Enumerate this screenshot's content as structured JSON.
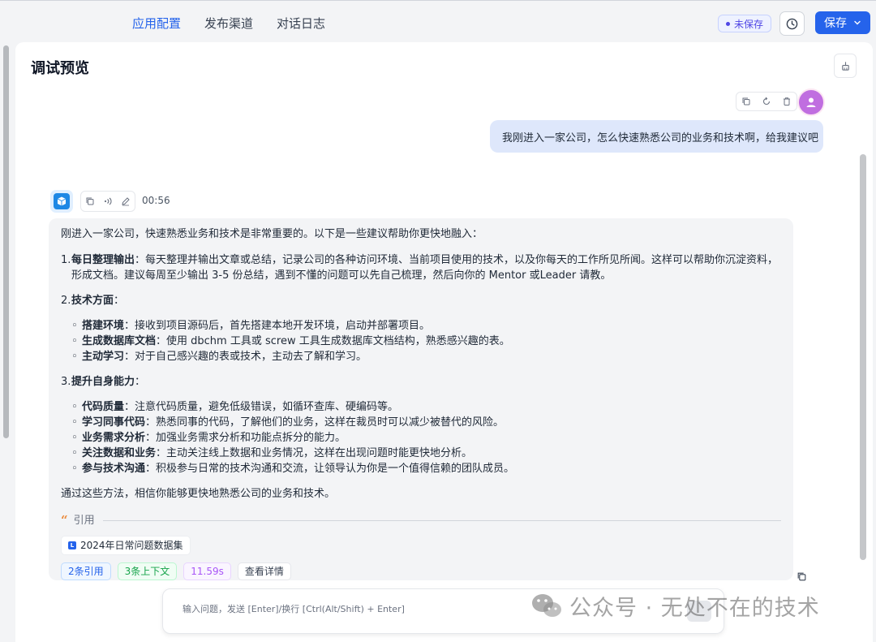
{
  "nav": {
    "tabs": [
      {
        "label": "应用配置",
        "active": true
      },
      {
        "label": "发布渠道",
        "active": false
      },
      {
        "label": "对话日志",
        "active": false
      }
    ]
  },
  "header": {
    "unsaved_label": "未保存",
    "save_label": "保存"
  },
  "panel": {
    "title": "调试预览"
  },
  "user_message": {
    "text": "我刚进入一家公司，怎么快速熟悉公司的业务和技术啊，给我建议吧"
  },
  "bot_message": {
    "time": "00:56",
    "intro": "刚进入一家公司，快速熟悉业务和技术是非常重要的。以下是一些建议帮助你更快地融入：",
    "sections": [
      {
        "num": "1.",
        "title": "每日整理输出",
        "text": "：每天整理并输出文章或总结，记录公司的各种访问环境、当前项目使用的技术，以及你每天的工作所见所闻。这样可以帮助你沉淀资料，形成文档。建议每周至少输出 3-5 份总结，遇到不懂的问题可以先自己梳理，然后向你的 Mentor 或Leader 请教。"
      },
      {
        "num": "2.",
        "title": "技术方面",
        "text": "：",
        "items": [
          {
            "title": "搭建环境",
            "text": "：接收到项目源码后，首先搭建本地开发环境，启动并部署项目。"
          },
          {
            "title": "生成数据库文档",
            "text": "：使用 dbchm 工具或 screw 工具生成数据库文档结构，熟悉感兴趣的表。"
          },
          {
            "title": "主动学习",
            "text": "：对于自己感兴趣的表或技术，主动去了解和学习。"
          }
        ]
      },
      {
        "num": "3.",
        "title": "提升自身能力",
        "text": "：",
        "items": [
          {
            "title": "代码质量",
            "text": "：注意代码质量，避免低级错误，如循环查库、硬编码等。"
          },
          {
            "title": "学习同事代码",
            "text": "：熟悉同事的代码，了解他们的业务，这样在裁员时可以减少被替代的风险。"
          },
          {
            "title": "业务需求分析",
            "text": "：加强业务需求分析和功能点拆分的能力。"
          },
          {
            "title": "关注数据和业务",
            "text": "：主动关注线上数据和业务情况，这样在出现问题时能更快地分析。"
          },
          {
            "title": "参与技术沟通",
            "text": "：积极参与日常的技术沟通和交流，让领导认为你是一个值得信赖的团队成员。"
          }
        ]
      }
    ],
    "conclusion": "通过这些方法，相信你能够更快地熟悉公司的业务和技术。",
    "quote_label": "引用",
    "dataset": "2024年日常问题数据集",
    "tags": {
      "citations": "2条引用",
      "context": "3条上下文",
      "duration": "11.59s",
      "details": "查看详情"
    }
  },
  "input": {
    "placeholder": "输入问题，发送 [Enter]/换行 [Ctrl(Alt/Shift) + Enter]"
  },
  "watermark": {
    "text": "公众号 · 无处不在的技术"
  },
  "colors": {
    "accent": "#2563eb",
    "user_bubble": "#dee7fb",
    "bot_bubble": "#f3f4f6"
  }
}
